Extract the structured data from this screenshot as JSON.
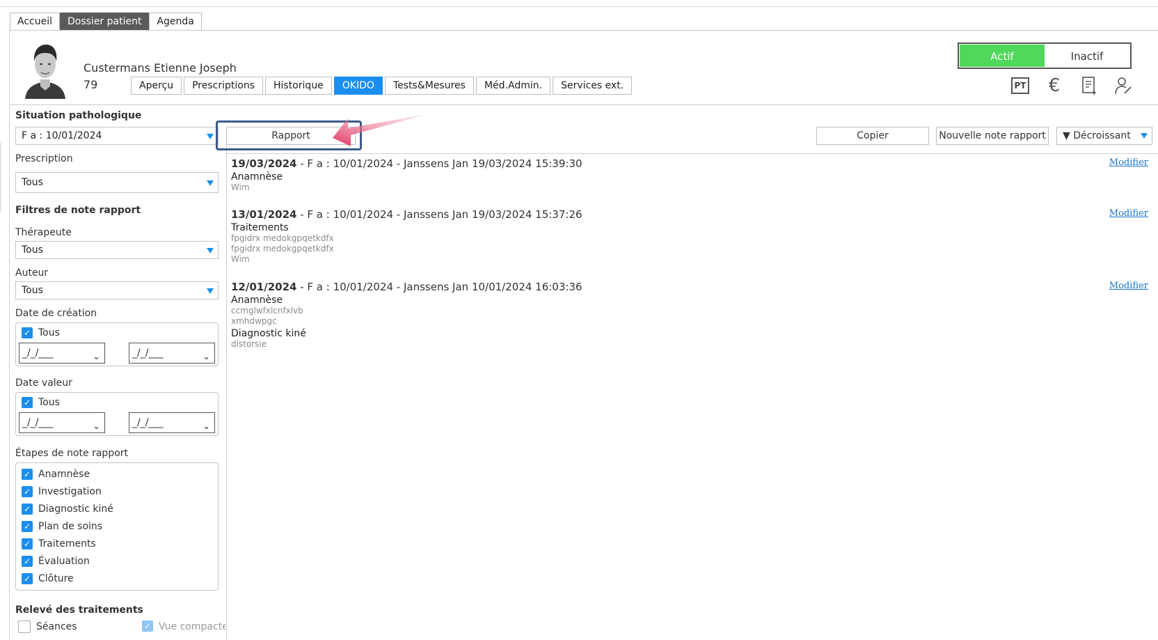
{
  "main_tabs": [
    "Accueil",
    "Dossier patient",
    "Agenda"
  ],
  "main_tab_active": "Dossier patient",
  "patient": {
    "name": "Custermans Etienne Joseph",
    "id": "79"
  },
  "sub_tabs": [
    "Aperçu",
    "Prescriptions",
    "Historique",
    "OKIDO",
    "Tests&Mesures",
    "Méd.Admin.",
    "Services ext."
  ],
  "sub_tab_active": "OKIDO",
  "status_toggle": {
    "on": "Actif",
    "off": "Inactif"
  },
  "header_icons": [
    "pt-icon",
    "euro-icon",
    "document-add-icon",
    "user-edit-icon"
  ],
  "icon_texts": {
    "pt": "PT",
    "euro": "€"
  },
  "left": {
    "situation_label": "Situation pathologique",
    "situation_value": "F a : 10/01/2024",
    "prescription_label": "Prescription",
    "prescription_value": "Tous",
    "filters_title": "Filtres de note rapport",
    "therapeute_label": "Thérapeute",
    "therapeute_value": "Tous",
    "auteur_label": "Auteur",
    "auteur_value": "Tous",
    "date_creation_label": "Date de création",
    "date_creation_all": "Tous",
    "date_valeur_label": "Date valeur",
    "date_valeur_all": "Tous",
    "date_placeholder": "_/_/___",
    "etapes_label": "Étapes de note rapport",
    "etapes": [
      "Anamnèse",
      "Investigation",
      "Diagnostic kiné",
      "Plan de soins",
      "Traitements",
      "Évaluation",
      "Clôture"
    ],
    "releve_title": "Relevé des traitements",
    "seances_label": "Séances",
    "vue_compacte_label": "Vue compacte"
  },
  "toolbar": {
    "rapport": "Rapport",
    "copier": "Copier",
    "nouvelle": "Nouvelle note rapport",
    "sort": "▼ Décroissant"
  },
  "notes": [
    {
      "date": "19/03/2024",
      "rest": " - F a : 10/01/2024 - Janssens Jan 19/03/2024 15:39:30",
      "sections": [
        {
          "title": "Anamnèse",
          "lines": [
            "Wim"
          ]
        }
      ],
      "action": "Modifier"
    },
    {
      "date": "13/01/2024",
      "rest": " - F a : 10/01/2024 - Janssens Jan 19/03/2024 15:37:26",
      "sections": [
        {
          "title": "Traitements",
          "lines": [
            "fpgidrx medokgpqetkdfx",
            "fpgidrx medokgpqetkdfx",
            "Wim"
          ]
        }
      ],
      "action": "Modifier"
    },
    {
      "date": "12/01/2024",
      "rest": " - F a : 10/01/2024 - Janssens Jan 10/01/2024 16:03:36",
      "sections": [
        {
          "title": "Anamnèse",
          "lines": [
            "ccmglwfxlcnfxlvb",
            "xmhdwpgc"
          ]
        },
        {
          "title": "Diagnostic kiné",
          "lines": [
            "distorsie"
          ]
        }
      ],
      "action": "Modifier"
    }
  ],
  "colors": {
    "accent": "#1a8ff0",
    "active_green": "#4fd85a",
    "tab_dark": "#5a5a5a",
    "annotation_arrow": "#e0325f",
    "link": "#1a73c8"
  }
}
